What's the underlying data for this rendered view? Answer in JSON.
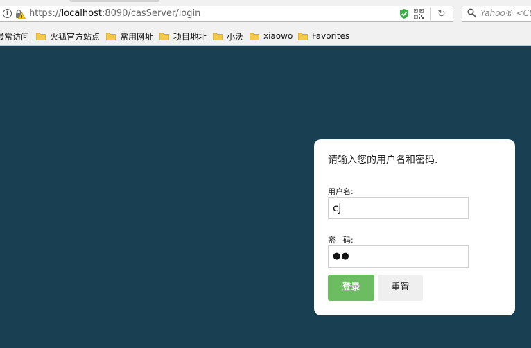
{
  "browser": {
    "url_scheme": "https://",
    "url_host": "localhost",
    "url_rest": ":8090/casServer/login",
    "search_placeholder": "Yahoo® <Ctrl+K>",
    "bookmarks": [
      {
        "label": "最常访问"
      },
      {
        "label": "火狐官方站点"
      },
      {
        "label": "常用网址"
      },
      {
        "label": "项目地址"
      },
      {
        "label": "小沃"
      },
      {
        "label": "xiaowo"
      },
      {
        "label": "Favorites"
      }
    ]
  },
  "login": {
    "prompt": "请输入您的用户名和密码.",
    "username_label": "用户名:",
    "username_value": "cj",
    "password_label": "密　码:",
    "password_mask": "●●",
    "login_button": "登录",
    "reset_button": "重置"
  },
  "colors": {
    "page_background": "#184052",
    "login_button": "#6cbc62",
    "reset_button": "#efefef"
  }
}
